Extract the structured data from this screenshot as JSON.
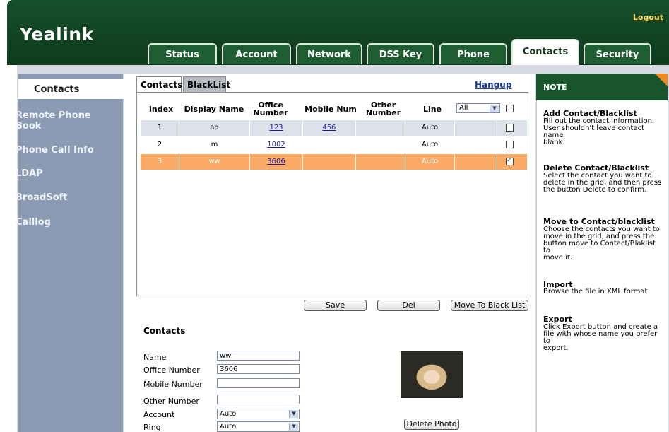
{
  "header": {
    "logo": "Yealink",
    "logout": "Logout"
  },
  "nav_tabs": [
    "Status",
    "Account",
    "Network",
    "DSS Key",
    "Phone",
    "Contacts",
    "Security"
  ],
  "active_tab": "Contacts",
  "sidebar": {
    "active": "Contacts",
    "items": [
      "Remote Phone Book",
      "Phone Call Info",
      "LDAP",
      "BroadSoft",
      "Calllog"
    ]
  },
  "sub_tabs": {
    "contacts": "Contacts",
    "blacklist": "BlackList"
  },
  "hangup": "Hangup",
  "table": {
    "headers": {
      "index": "Index",
      "display_name": "Display Name",
      "office_number": "Office Number",
      "mobile_num": "Mobile Num",
      "other_number": "Other Number",
      "line": "Line"
    },
    "line_filter": "All",
    "rows": [
      {
        "index": "1",
        "display_name": "ad",
        "office_number": "123",
        "mobile_num": "456",
        "other_number": "",
        "line": "Auto",
        "checked": false,
        "selected": false
      },
      {
        "index": "2",
        "display_name": "m",
        "office_number": "1002",
        "mobile_num": "",
        "other_number": "",
        "line": "Auto",
        "checked": false,
        "selected": false
      },
      {
        "index": "3",
        "display_name": "ww",
        "office_number": "3606",
        "mobile_num": "",
        "other_number": "",
        "line": "Auto",
        "checked": true,
        "selected": true
      }
    ]
  },
  "buttons": {
    "save": "Save",
    "del": "Del",
    "move_to_blacklist": "Move To Black List",
    "delete_photo": "Delete Photo"
  },
  "form": {
    "title": "Contacts",
    "name_label": "Name",
    "name_value": "ww",
    "office_label": "Office Number",
    "office_value": "3606",
    "mobile_label": "Mobile Number",
    "mobile_value": "",
    "other_label": "Other Number",
    "other_value": "",
    "account_label": "Account",
    "account_value": "Auto",
    "ring_label": "Ring",
    "ring_value": "Auto"
  },
  "note": {
    "heading": "NOTE",
    "sections": [
      {
        "title": "Add Contact/Blacklist",
        "lines": [
          "Fill out the contact information.",
          "User shouldn't leave contact name",
          "blank."
        ]
      },
      {
        "title": "Delete Contact/Blacklist",
        "lines": [
          "Select the contact you want to",
          "delete in the grid, and then press",
          "the button Delete to confirm."
        ]
      },
      {
        "title": "Move to Contact/blacklist",
        "lines": [
          "Choose the contacts you want to",
          "move in the grid, and press the",
          "button move to Contact/Blaklist to",
          "move it."
        ]
      },
      {
        "title": "Import",
        "lines": [
          "Browse the file in XML format."
        ]
      },
      {
        "title": "Export",
        "lines": [
          "Click Export button and create a",
          "file with whose name you prefer to",
          "export."
        ]
      }
    ]
  },
  "colors": {
    "header_green": "#174f2a",
    "sidebar": "#8b9bb3",
    "selected_row": "#fbaa66",
    "row_alt": "#dde2ea",
    "link": "#1f3fa0"
  }
}
